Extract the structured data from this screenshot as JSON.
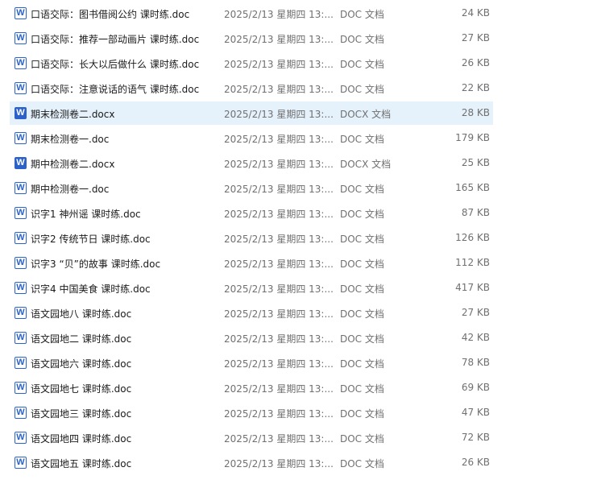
{
  "files": [
    {
      "name": "口语交际：图书借阅公约 课时练.doc",
      "date": "2025/2/13 星期四 13:...",
      "type": "DOC 文档",
      "size": "24 KB",
      "icon": "word-doc-icon",
      "selected": false
    },
    {
      "name": "口语交际：推荐一部动画片 课时练.doc",
      "date": "2025/2/13 星期四 13:...",
      "type": "DOC 文档",
      "size": "27 KB",
      "icon": "word-doc-icon",
      "selected": false
    },
    {
      "name": "口语交际：长大以后做什么 课时练.doc",
      "date": "2025/2/13 星期四 13:...",
      "type": "DOC 文档",
      "size": "26 KB",
      "icon": "word-doc-icon",
      "selected": false
    },
    {
      "name": "口语交际：注意说话的语气 课时练.doc",
      "date": "2025/2/13 星期四 13:...",
      "type": "DOC 文档",
      "size": "22 KB",
      "icon": "word-doc-icon",
      "selected": false
    },
    {
      "name": "期末检测卷二.docx",
      "date": "2025/2/13 星期四 13:...",
      "type": "DOCX 文档",
      "size": "28 KB",
      "icon": "word-docx-icon",
      "selected": true
    },
    {
      "name": "期末检测卷一.doc",
      "date": "2025/2/13 星期四 13:...",
      "type": "DOC 文档",
      "size": "179 KB",
      "icon": "word-doc-icon",
      "selected": false
    },
    {
      "name": "期中检测卷二.docx",
      "date": "2025/2/13 星期四 13:...",
      "type": "DOCX 文档",
      "size": "25 KB",
      "icon": "word-docx-icon",
      "selected": false
    },
    {
      "name": "期中检测卷一.doc",
      "date": "2025/2/13 星期四 13:...",
      "type": "DOC 文档",
      "size": "165 KB",
      "icon": "word-doc-icon",
      "selected": false
    },
    {
      "name": "识字1 神州谣 课时练.doc",
      "date": "2025/2/13 星期四 13:...",
      "type": "DOC 文档",
      "size": "87 KB",
      "icon": "word-doc-icon",
      "selected": false
    },
    {
      "name": "识字2 传统节日 课时练.doc",
      "date": "2025/2/13 星期四 13:...",
      "type": "DOC 文档",
      "size": "126 KB",
      "icon": "word-doc-icon",
      "selected": false
    },
    {
      "name": "识字3 “贝”的故事 课时练.doc",
      "date": "2025/2/13 星期四 13:...",
      "type": "DOC 文档",
      "size": "112 KB",
      "icon": "word-doc-icon",
      "selected": false
    },
    {
      "name": "识字4 中国美食 课时练.doc",
      "date": "2025/2/13 星期四 13:...",
      "type": "DOC 文档",
      "size": "417 KB",
      "icon": "word-doc-icon",
      "selected": false
    },
    {
      "name": "语文园地八 课时练.doc",
      "date": "2025/2/13 星期四 13:...",
      "type": "DOC 文档",
      "size": "27 KB",
      "icon": "word-doc-icon",
      "selected": false
    },
    {
      "name": "语文园地二 课时练.doc",
      "date": "2025/2/13 星期四 13:...",
      "type": "DOC 文档",
      "size": "42 KB",
      "icon": "word-doc-icon",
      "selected": false
    },
    {
      "name": "语文园地六 课时练.doc",
      "date": "2025/2/13 星期四 13:...",
      "type": "DOC 文档",
      "size": "78 KB",
      "icon": "word-doc-icon",
      "selected": false
    },
    {
      "name": "语文园地七 课时练.doc",
      "date": "2025/2/13 星期四 13:...",
      "type": "DOC 文档",
      "size": "69 KB",
      "icon": "word-doc-icon",
      "selected": false
    },
    {
      "name": "语文园地三 课时练.doc",
      "date": "2025/2/13 星期四 13:...",
      "type": "DOC 文档",
      "size": "47 KB",
      "icon": "word-doc-icon",
      "selected": false
    },
    {
      "name": "语文园地四 课时练.doc",
      "date": "2025/2/13 星期四 13:...",
      "type": "DOC 文档",
      "size": "72 KB",
      "icon": "word-doc-icon",
      "selected": false
    },
    {
      "name": "语文园地五 课时练.doc",
      "date": "2025/2/13 星期四 13:...",
      "type": "DOC 文档",
      "size": "26 KB",
      "icon": "word-doc-icon",
      "selected": false
    }
  ],
  "icon_letter": "W",
  "colors": {
    "word_blue": "#2b62c9",
    "selected_bg": "#e5f1fb",
    "meta_text": "#707070"
  }
}
